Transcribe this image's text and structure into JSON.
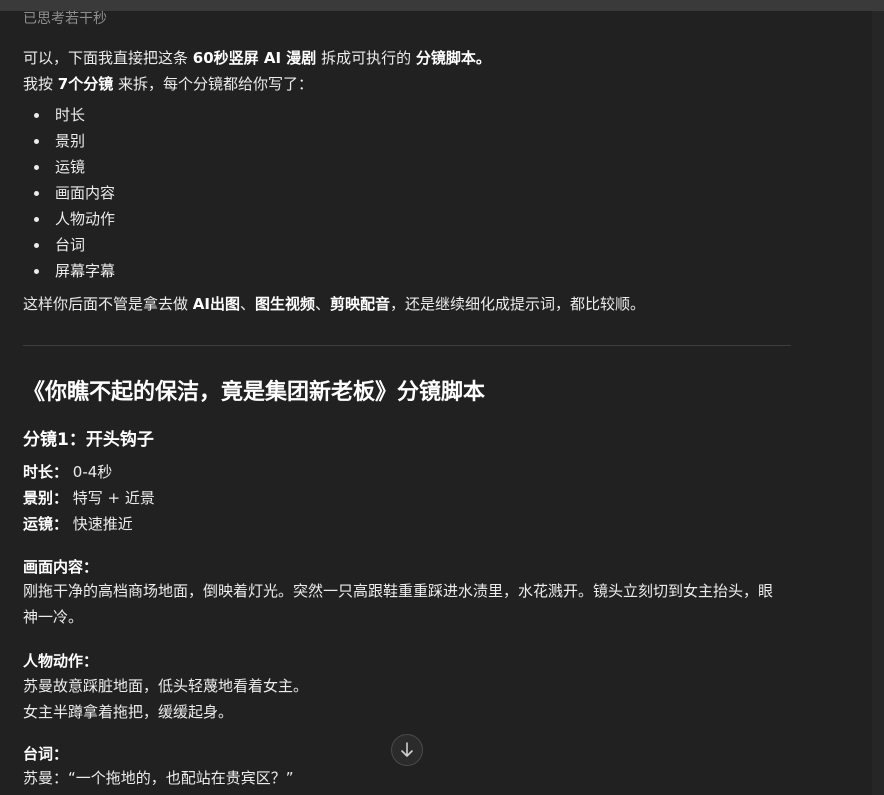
{
  "thought": {
    "label": "已思考若干秒"
  },
  "intro": {
    "line1_a": "可以，下面我直接把这条 ",
    "line1_b1": "60秒竖屏 AI 漫剧",
    "line1_c": " 拆成可执行的 ",
    "line1_b2": "分镜脚本。",
    "line2_a": "我按 ",
    "line2_b": "7个分镜",
    "line2_c": " 来拆，每个分镜都给你写了："
  },
  "bullets": [
    "时长",
    "景别",
    "运镜",
    "画面内容",
    "人物动作",
    "台词",
    "屏幕字幕"
  ],
  "outro": {
    "a": "这样你后面不管是拿去做 ",
    "b1": "AI出图",
    "s1": "、",
    "b2": "图生视频",
    "s2": "、",
    "b3": "剪映配音",
    "c": "，还是继续细化成提示词，都比较顺。"
  },
  "script_title": "《你瞧不起的保洁，竟是集团新老板》分镜脚本",
  "shot1": {
    "heading": "分镜1：开头钩子",
    "duration_label": "时长：",
    "duration_value": " 0-4秒",
    "shot_label": "景别：",
    "shot_value": " 特写 + 近景",
    "camera_label": "运镜：",
    "camera_value": " 快速推近",
    "visual_label": "画面内容：",
    "visual_text": "刚拖干净的高档商场地面，倒映着灯光。突然一只高跟鞋重重踩进水渍里，水花溅开。镜头立刻切到女主抬头，眼神一冷。",
    "action_label": "人物动作：",
    "action_line1": "苏曼故意踩脏地面，低头轻蔑地看着女主。",
    "action_line2": "女主半蹲拿着拖把，缓缓起身。",
    "dialogue_label": "台词：",
    "dialogue_line1": "苏曼：“一个拖地的，也配站在贵宾区？”"
  }
}
